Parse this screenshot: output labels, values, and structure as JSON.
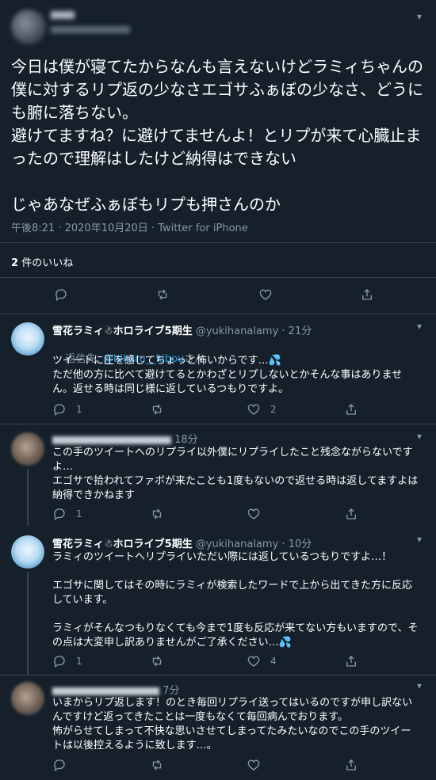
{
  "main_tweet": {
    "text": "今日は僕が寝てたからなんも言えないけどラミィちゃんの僕に対するリプ返の少なさエゴサふぁぼの少なさ、どうにも腑に落ちない。\n避けてますね？に避けてませんよ！とリプが来て心臓止まったので理解はしたけど納得はできない\n\nじゃあなぜふぁぼもリプも押さんのか",
    "time": "午後8:21",
    "date": "2020年10月20日",
    "source": "Twitter for iPhone",
    "likes_count": "2",
    "likes_label": "件のいいね"
  },
  "replies": [
    {
      "name": "雪花ラミィ☃ホロライブ5期生",
      "handle": "@yukihanalamy",
      "time": "21分",
      "reply_to_label": "返信先: ",
      "reply_to_handle": "@hikaru__kibou",
      "reply_to_suffix": "さん",
      "text": "ツイートに圧を感じてちょっと怖いからです…💦\nただ他の方に比べて避けてるとかわざとリプしないとかそんな事はありません。返せる時は同じ様に返しているつもりですよ。",
      "reply_count": "1",
      "like_count": "2"
    },
    {
      "name": "",
      "handle": "",
      "time": "18分",
      "text": "この手のツイートへのリプライ以外僕にリプライしたこと残念ながらないですよ…\nエゴサで拾われてファボが来たことも1度もないので返せる時は返してますよは納得できかねます",
      "reply_count": "1",
      "like_count": ""
    },
    {
      "name": "雪花ラミィ☃ホロライブ5期生",
      "handle": "@yukihanalamy",
      "time": "10分",
      "text": "ラミィのツイートへリプライいただい際には返しているつもりですよ…！\n\nエゴサに関してはその時にラミィが検索したワードで上から出てきた方に反応しています。\n\nラミィがそんなつもりなくても今まで1度も反応が来てない方もいますので、その点は大変申し訳ありませんがご了承ください…💦",
      "reply_count": "1",
      "like_count": "4"
    },
    {
      "name": "",
      "handle": "",
      "time": "7分",
      "text": "いまからリプ返します！のとき毎回リプライ送ってはいるのですが申し訳ないんですけど返ってきたことは一度もなくて毎回病んでおります。\n怖がらせてしまって不快な思いさせてしまってたみたいなのでこの手のツイートは以後控えるように致します…。",
      "reply_count": "",
      "like_count": ""
    }
  ],
  "colors": {
    "background": "#15202b",
    "divider": "#38444d",
    "muted": "#8899a6",
    "link": "#1da1f2"
  }
}
